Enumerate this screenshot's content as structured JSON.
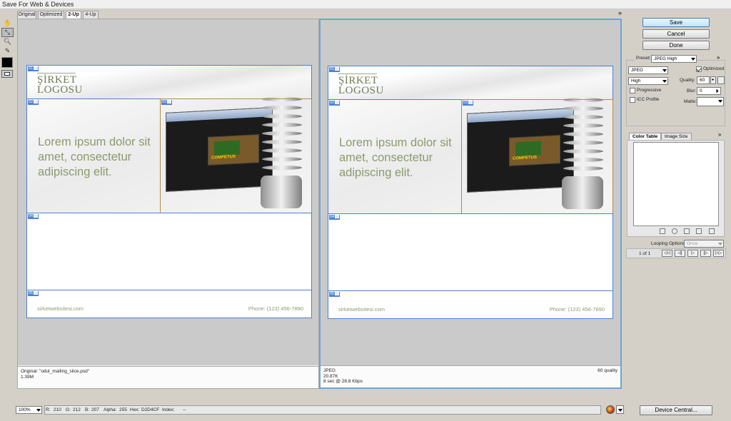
{
  "window": {
    "title": "Save For Web & Devices"
  },
  "view_tabs": [
    "Original",
    "Optimized",
    "2-Up",
    "4-Up"
  ],
  "active_tab": "2-Up",
  "panels_menu_glyph": "»",
  "mail": {
    "logo_line1": "ŞİRKET",
    "logo_line2": "LOGOSU",
    "lorem": "Lorem ipsum dolor sit amet, consectetur adipiscing elit.",
    "url": "sirketwebsitesi.com",
    "phone": "Phone: (123) 456-7890",
    "screenshot_banner": "COMPETUS"
  },
  "slices": [
    "01",
    "02",
    "03",
    "04",
    "05"
  ],
  "left_info": {
    "line1": "Original: \"odul_mailing_slice.psd\"",
    "line2": "1.39M"
  },
  "right_info": {
    "line1": "JPEG",
    "line2": "20.87K",
    "line3": "8 sec @ 28.8 Kbps",
    "quality": "60 quality"
  },
  "buttons": {
    "save": "Save",
    "cancel": "Cancel",
    "done": "Done",
    "device_central": "Device Central..."
  },
  "settings": {
    "preset_label": "Preset:",
    "preset_value": "JPEG High",
    "format": "JPEG",
    "quality_level": "High",
    "optimized_label": "Optimized",
    "optimized_checked": true,
    "quality_label": "Quality:",
    "quality_value": "60",
    "progressive_label": "Progressive",
    "progressive_checked": false,
    "blur_label": "Blur:",
    "blur_value": "0",
    "icc_label": "ICC Profile",
    "icc_checked": false,
    "matte_label": "Matte:"
  },
  "color_table": {
    "tab1": "Color Table",
    "tab2": "Image Size"
  },
  "animation": {
    "looping_label": "Looping Options:",
    "looping_value": "Once",
    "frame_counter": "1 of 1",
    "nav_glyphs": [
      "◁◁",
      "◁|",
      "▷",
      "|▷",
      "▷▷"
    ]
  },
  "statusbar": {
    "zoom": "100%",
    "r_label": "R:",
    "r_value": "210",
    "g_label": "G:",
    "g_value": "212",
    "b_label": "B:",
    "b_value": "207",
    "alpha_label": "Alpha:",
    "alpha_value": "255",
    "hex_label": "Hex:",
    "hex_value": "D2D4CF",
    "index_label": "Index:",
    "index_value": "--"
  },
  "colors": {
    "selection_border": "#6fa3d8",
    "slice_border": "#4f7fd0",
    "accent_text": "#8c9a6e",
    "default_button": "#bee6fd"
  }
}
